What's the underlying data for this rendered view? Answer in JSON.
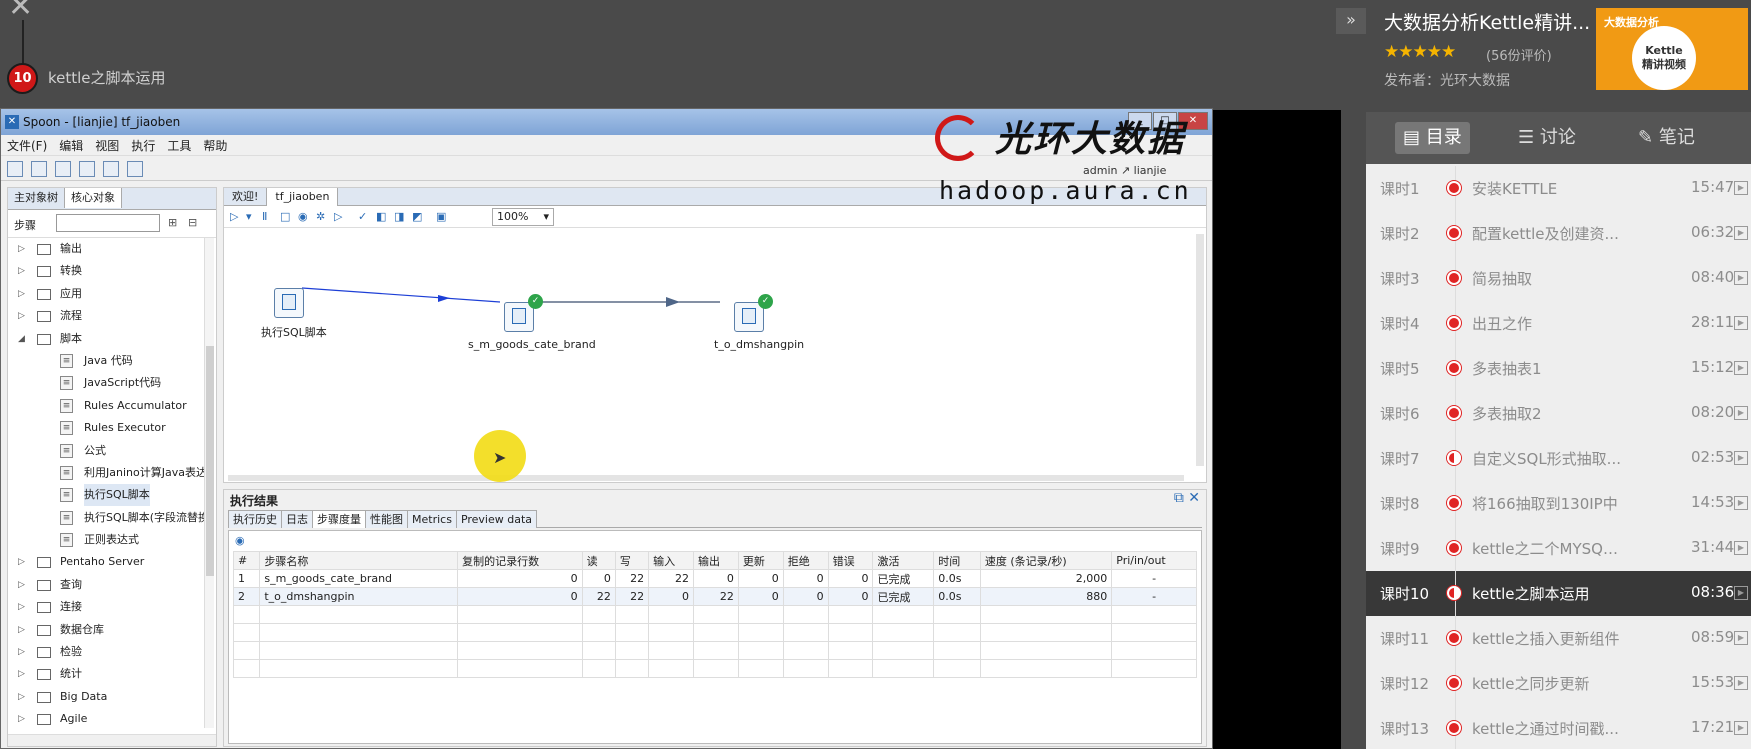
{
  "player": {
    "lesson_number": "10",
    "lesson_title": "kettle之脚本运用"
  },
  "course": {
    "title": "大数据分析Kettle精讲...",
    "stars": "★★★★★",
    "rating": "(56份评价)",
    "publisher": "发布者：光环大数据",
    "thumb_tag": "大数据分析",
    "thumb_line1": "Kettle",
    "thumb_line2": "精讲视频",
    "tabs": {
      "catalog": "目录",
      "discuss": "讨论",
      "notes": "笔记"
    },
    "lessons": [
      {
        "num": "课时1",
        "name": "安装KETTLE",
        "dur": "15:47"
      },
      {
        "num": "课时2",
        "name": "配置kettle及创建资...",
        "dur": "06:32"
      },
      {
        "num": "课时3",
        "name": "简易抽取",
        "dur": "08:40"
      },
      {
        "num": "课时4",
        "name": "出丑之作",
        "dur": "28:11"
      },
      {
        "num": "课时5",
        "name": "多表抽表1",
        "dur": "15:12"
      },
      {
        "num": "课时6",
        "name": "多表抽取2",
        "dur": "08:20"
      },
      {
        "num": "课时7",
        "name": "自定义SQL形式抽取...",
        "dur": "02:53"
      },
      {
        "num": "课时8",
        "name": "将166抽取到130IP中",
        "dur": "14:53"
      },
      {
        "num": "课时9",
        "name": "kettle之二个MYSQL...",
        "dur": "31:44"
      },
      {
        "num": "课时10",
        "name": "kettle之脚本运用",
        "dur": "08:36"
      },
      {
        "num": "课时11",
        "name": "kettle之插入更新组件",
        "dur": "08:59"
      },
      {
        "num": "课时12",
        "name": "kettle之同步更新",
        "dur": "15:53"
      },
      {
        "num": "课时13",
        "name": "kettle之通过时间戳...",
        "dur": "17:21"
      }
    ]
  },
  "watermark": {
    "cn": "光环大数据",
    "url": "hadoop.aura.cn",
    "user": "admin ↗ lianjie"
  },
  "spoon": {
    "title": "Spoon - [lianjie] tf_jiaoben",
    "menu": [
      "文件(F)",
      "编辑",
      "视图",
      "执行",
      "工具",
      "帮助"
    ],
    "left_tabs": [
      "主对象树",
      "核心对象"
    ],
    "search_label": "步骤",
    "tree": [
      {
        "label": "输出",
        "type": "folder"
      },
      {
        "label": "转换",
        "type": "folder"
      },
      {
        "label": "应用",
        "type": "folder"
      },
      {
        "label": "流程",
        "type": "folder"
      },
      {
        "label": "脚本",
        "type": "folder-open"
      },
      {
        "label": "Java 代码",
        "type": "child"
      },
      {
        "label": "JavaScript代码",
        "type": "child"
      },
      {
        "label": "Rules Accumulator",
        "type": "child"
      },
      {
        "label": "Rules Executor",
        "type": "child"
      },
      {
        "label": "公式",
        "type": "child"
      },
      {
        "label": "利用Janino计算Java表达",
        "type": "child"
      },
      {
        "label": "执行SQL脚本",
        "type": "child-sel"
      },
      {
        "label": "执行SQL脚本(字段流替换",
        "type": "child"
      },
      {
        "label": "正则表达式",
        "type": "child"
      },
      {
        "label": "Pentaho Server",
        "type": "folder"
      },
      {
        "label": "查询",
        "type": "folder"
      },
      {
        "label": "连接",
        "type": "folder"
      },
      {
        "label": "数据仓库",
        "type": "folder"
      },
      {
        "label": "检验",
        "type": "folder"
      },
      {
        "label": "统计",
        "type": "folder"
      },
      {
        "label": "Big Data",
        "type": "folder"
      },
      {
        "label": "Agile",
        "type": "folder"
      }
    ],
    "editor_tabs": [
      "欢迎!",
      "tf_jiaoben"
    ],
    "zoom": "100%",
    "steps": {
      "sql": "执行SQL脚本",
      "source": "s_m_goods_cate_brand",
      "target": "t_o_dmshangpin"
    },
    "results": {
      "title": "执行结果",
      "tabs": [
        "执行历史",
        "日志",
        "步骤度量",
        "性能图",
        "Metrics",
        "Preview data"
      ],
      "columns": [
        "#",
        "步骤名称",
        "复制的记录行数",
        "读",
        "写",
        "输入",
        "输出",
        "更新",
        "拒绝",
        "错误",
        "激活",
        "时间",
        "速度 (条记录/秒)",
        "Pri/in/out"
      ],
      "rows": [
        [
          "1",
          "s_m_goods_cate_brand",
          "0",
          "0",
          "22",
          "22",
          "0",
          "0",
          "0",
          "0",
          "已完成",
          "0.0s",
          "2,000",
          "-"
        ],
        [
          "2",
          "t_o_dmshangpin",
          "0",
          "22",
          "22",
          "0",
          "22",
          "0",
          "0",
          "0",
          "已完成",
          "0.0s",
          "880",
          "-"
        ]
      ]
    }
  }
}
